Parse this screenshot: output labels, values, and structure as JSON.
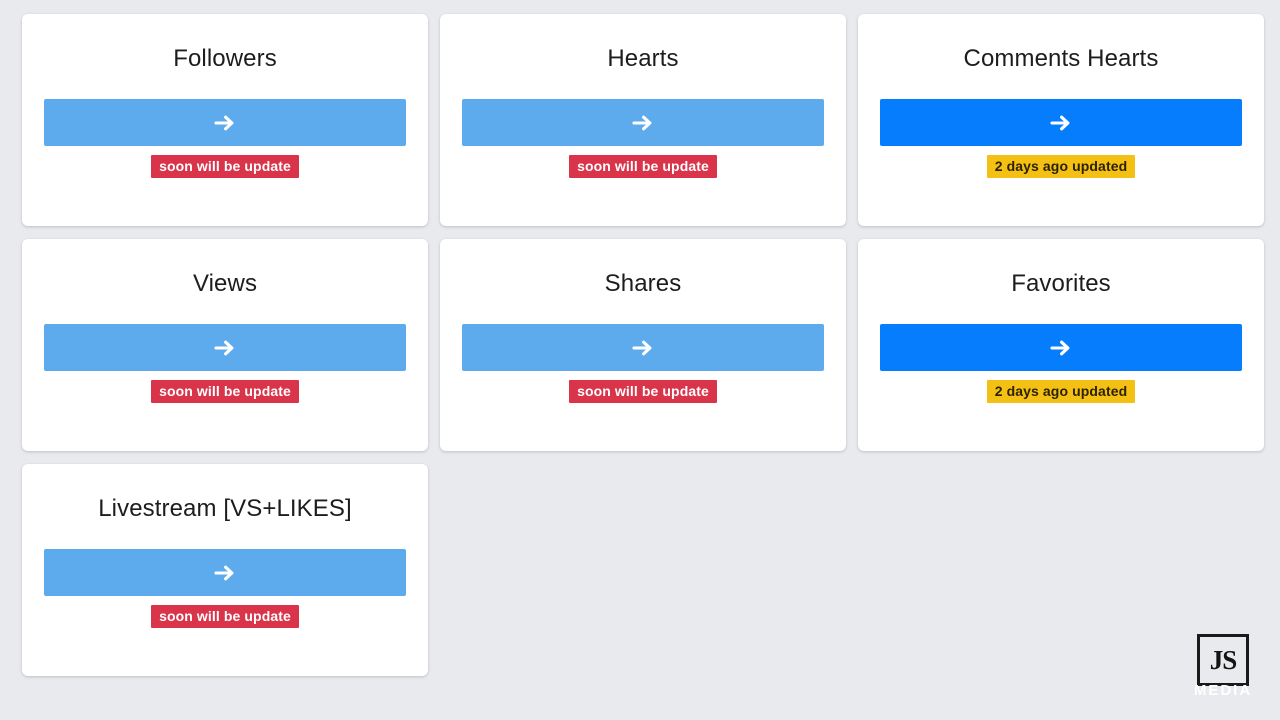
{
  "page": {
    "background_color": "#e9eaee",
    "card_background_color": "#ffffff"
  },
  "colors": {
    "accent_light_blue": "#5dabec",
    "accent_strong_blue": "#067dfd",
    "badge_pending_bg": "#d93449",
    "badge_pending_text": "#ffffff",
    "badge_updated_bg": "#f5c014",
    "badge_updated_text": "#2b2300",
    "title_text": "#1d1d1f"
  },
  "cards": [
    {
      "title": "Followers",
      "button_icon": "arrow-right-icon",
      "button_style": "light",
      "badge_label": "soon will be update",
      "badge_style": "pending"
    },
    {
      "title": "Hearts",
      "button_icon": "arrow-right-icon",
      "button_style": "light",
      "badge_label": "soon will be update",
      "badge_style": "pending"
    },
    {
      "title": "Comments Hearts",
      "button_icon": "arrow-right-icon",
      "button_style": "strong",
      "badge_label": "2 days ago updated",
      "badge_style": "updated"
    },
    {
      "title": "Views",
      "button_icon": "arrow-right-icon",
      "button_style": "light",
      "badge_label": "soon will be update",
      "badge_style": "pending"
    },
    {
      "title": "Shares",
      "button_icon": "arrow-right-icon",
      "button_style": "light",
      "badge_label": "soon will be update",
      "badge_style": "pending"
    },
    {
      "title": "Favorites",
      "button_icon": "arrow-right-icon",
      "button_style": "strong",
      "badge_label": "2 days ago updated",
      "badge_style": "updated"
    },
    {
      "title": "Livestream [VS+LIKES]",
      "button_icon": "arrow-right-icon",
      "button_style": "light",
      "badge_label": "soon will be update",
      "badge_style": "pending"
    }
  ],
  "watermark": {
    "mark_text": "JS",
    "caption": "MEDIA"
  }
}
